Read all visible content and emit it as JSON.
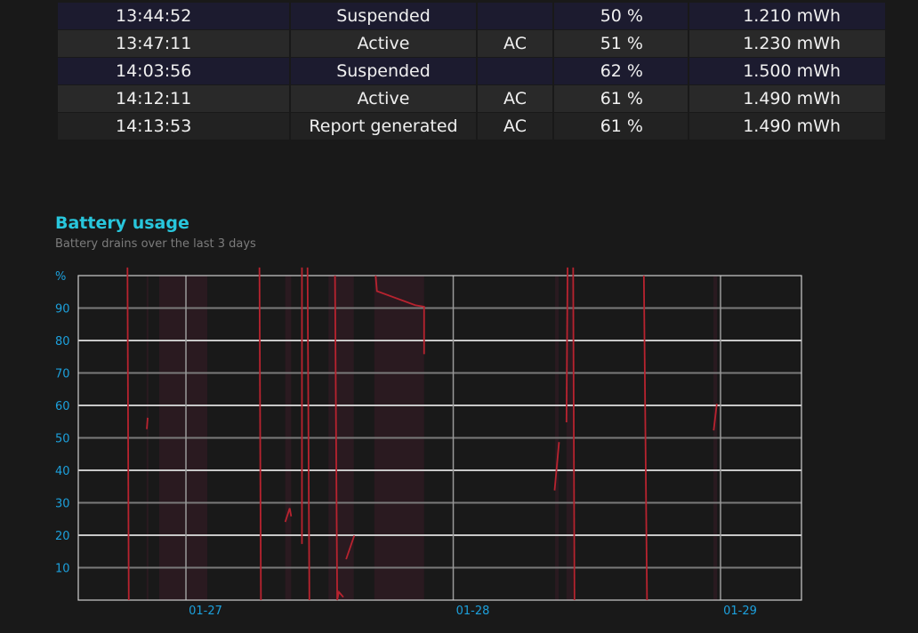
{
  "table": {
    "rows": [
      {
        "time": "13:44:52",
        "state": "Suspended",
        "source": "",
        "percent": "50 %",
        "capacity": "1.210 mWh",
        "kind": "suspended"
      },
      {
        "time": "13:47:11",
        "state": "Active",
        "source": "AC",
        "percent": "51 %",
        "capacity": "1.230 mWh",
        "kind": "active"
      },
      {
        "time": "14:03:56",
        "state": "Suspended",
        "source": "",
        "percent": "62 %",
        "capacity": "1.500 mWh",
        "kind": "suspended"
      },
      {
        "time": "14:12:11",
        "state": "Active",
        "source": "AC",
        "percent": "61 %",
        "capacity": "1.490 mWh",
        "kind": "active"
      },
      {
        "time": "14:13:53",
        "state": "Report generated",
        "source": "AC",
        "percent": "61 %",
        "capacity": "1.490 mWh",
        "kind": "report"
      }
    ]
  },
  "section": {
    "title": "Battery usage",
    "subtitle": "Battery drains over the last 3 days"
  },
  "chart_data": {
    "type": "line",
    "x_range": [
      "01-26 14:20",
      "01-29 07:16"
    ],
    "ylim": [
      0,
      100
    ],
    "y_unit_label": "%",
    "y_ticks": [
      10,
      20,
      30,
      40,
      50,
      60,
      70,
      80,
      90
    ],
    "x_ticks": [
      {
        "label": "01-27",
        "at": "01-27 00:00"
      },
      {
        "label": "01-28",
        "at": "01-28 00:00"
      },
      {
        "label": "01-29",
        "at": "01-29 00:00"
      }
    ],
    "grid": true,
    "colors": {
      "line": "#b8232f",
      "suspended_band": "#2a1a20",
      "tick_label": "#1ca0dc",
      "title": "#28c6dc"
    },
    "suspended_periods": [
      [
        "01-26 20:28",
        "01-26 20:36"
      ],
      [
        "01-26 21:36",
        "01-27 01:55"
      ],
      [
        "01-27 08:55",
        "01-27 09:27"
      ],
      [
        "01-27 12:48",
        "01-27 15:04"
      ],
      [
        "01-27 16:55",
        "01-27 21:23"
      ],
      [
        "01-28 09:09",
        "01-28 09:28"
      ],
      [
        "01-28 10:10",
        "01-28 10:44"
      ],
      [
        "01-28 23:22",
        "01-28 23:41"
      ]
    ],
    "drain_segments": [
      [
        [
          "01-26 18:45",
          102.5
        ],
        [
          "01-26 18:52",
          0
        ]
      ],
      [
        [
          "01-26 20:29",
          52.7
        ],
        [
          "01-26 20:34",
          56.2
        ]
      ],
      [
        [
          "01-27 06:36",
          102.5
        ],
        [
          "01-27 06:44",
          0
        ]
      ],
      [
        [
          "01-27 08:55",
          24.1
        ],
        [
          "01-27 09:19",
          28.3
        ],
        [
          "01-27 09:27",
          25.8
        ]
      ],
      [
        [
          "01-27 10:25",
          102.5
        ],
        [
          "01-27 10:25",
          17.3
        ]
      ],
      [
        [
          "01-27 10:55",
          102.5
        ],
        [
          "01-27 11:05",
          0
        ]
      ],
      [
        [
          "01-27 13:23",
          100
        ],
        [
          "01-27 13:35",
          0
        ],
        [
          "01-27 13:44",
          2.5
        ],
        [
          "01-27 14:08",
          0.9
        ]
      ],
      [
        [
          "01-27 14:23",
          12.6
        ],
        [
          "01-27 15:07",
          19.9
        ]
      ],
      [
        [
          "01-27 17:02",
          100
        ],
        [
          "01-27 17:09",
          95.2
        ],
        [
          "01-27 20:35",
          90.9
        ],
        [
          "01-27 21:23",
          90.4
        ],
        [
          "01-27 21:23",
          75.8
        ]
      ],
      [
        [
          "01-28 09:06",
          33.8
        ],
        [
          "01-28 09:30",
          48.7
        ]
      ],
      [
        [
          "01-28 10:16",
          102.5
        ],
        [
          "01-28 10:10",
          54.8
        ]
      ],
      [
        [
          "01-28 10:46",
          102.5
        ],
        [
          "01-28 10:53",
          0
        ]
      ],
      [
        [
          "01-28 17:07",
          100
        ],
        [
          "01-28 17:24",
          0
        ]
      ],
      [
        [
          "01-28 23:23",
          52.3
        ],
        [
          "01-28 23:40",
          60.5
        ]
      ]
    ]
  }
}
